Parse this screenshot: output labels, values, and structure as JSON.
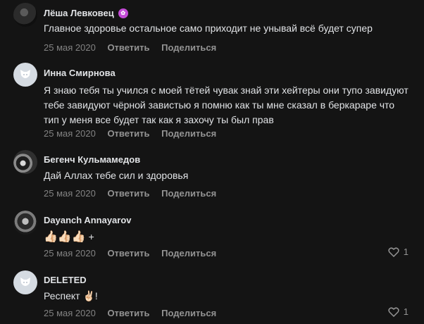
{
  "comments": [
    {
      "author": "Лёша Левковец",
      "badge_icon": "pink-creature-badge",
      "text": "Главное здоровье остальное само приходит не унывай всё будет супер",
      "date": "25 мая 2020",
      "reply": "Ответить",
      "share": "Поделиться"
    },
    {
      "author": "Инна Смирнова",
      "text": "Я знаю тебя ты учился с моей тётей чувак знай эти хейтеры они тупо завидуют тебе завидуют чёрной завистью я помню как ты мне сказал в беркараре что тип у меня все будет так как я захочу ты был прав",
      "date": "25 мая 2020",
      "reply": "Ответить",
      "share": "Поделиться"
    },
    {
      "author": "Бегенч Кульмамедов",
      "text": "Дай Аллах тебе сил и здоровья",
      "date": "25 мая 2020",
      "reply": "Ответить",
      "share": "Поделиться"
    },
    {
      "author": "Dayanch Annayarov",
      "text_emoji": "👍🏻👍🏻👍🏻",
      "text": "+",
      "date": "25 мая 2020",
      "reply": "Ответить",
      "share": "Поделиться",
      "likes": "1"
    },
    {
      "author": "DELETED",
      "text": "Респект",
      "text_emoji": "✌🏻",
      "text_suffix": "!",
      "date": "25 мая 2020",
      "reply": "Ответить",
      "share": "Поделиться",
      "likes": "1"
    }
  ],
  "colors": {
    "background": "#141414",
    "text": "#e1e3e6",
    "meta": "#828282"
  }
}
